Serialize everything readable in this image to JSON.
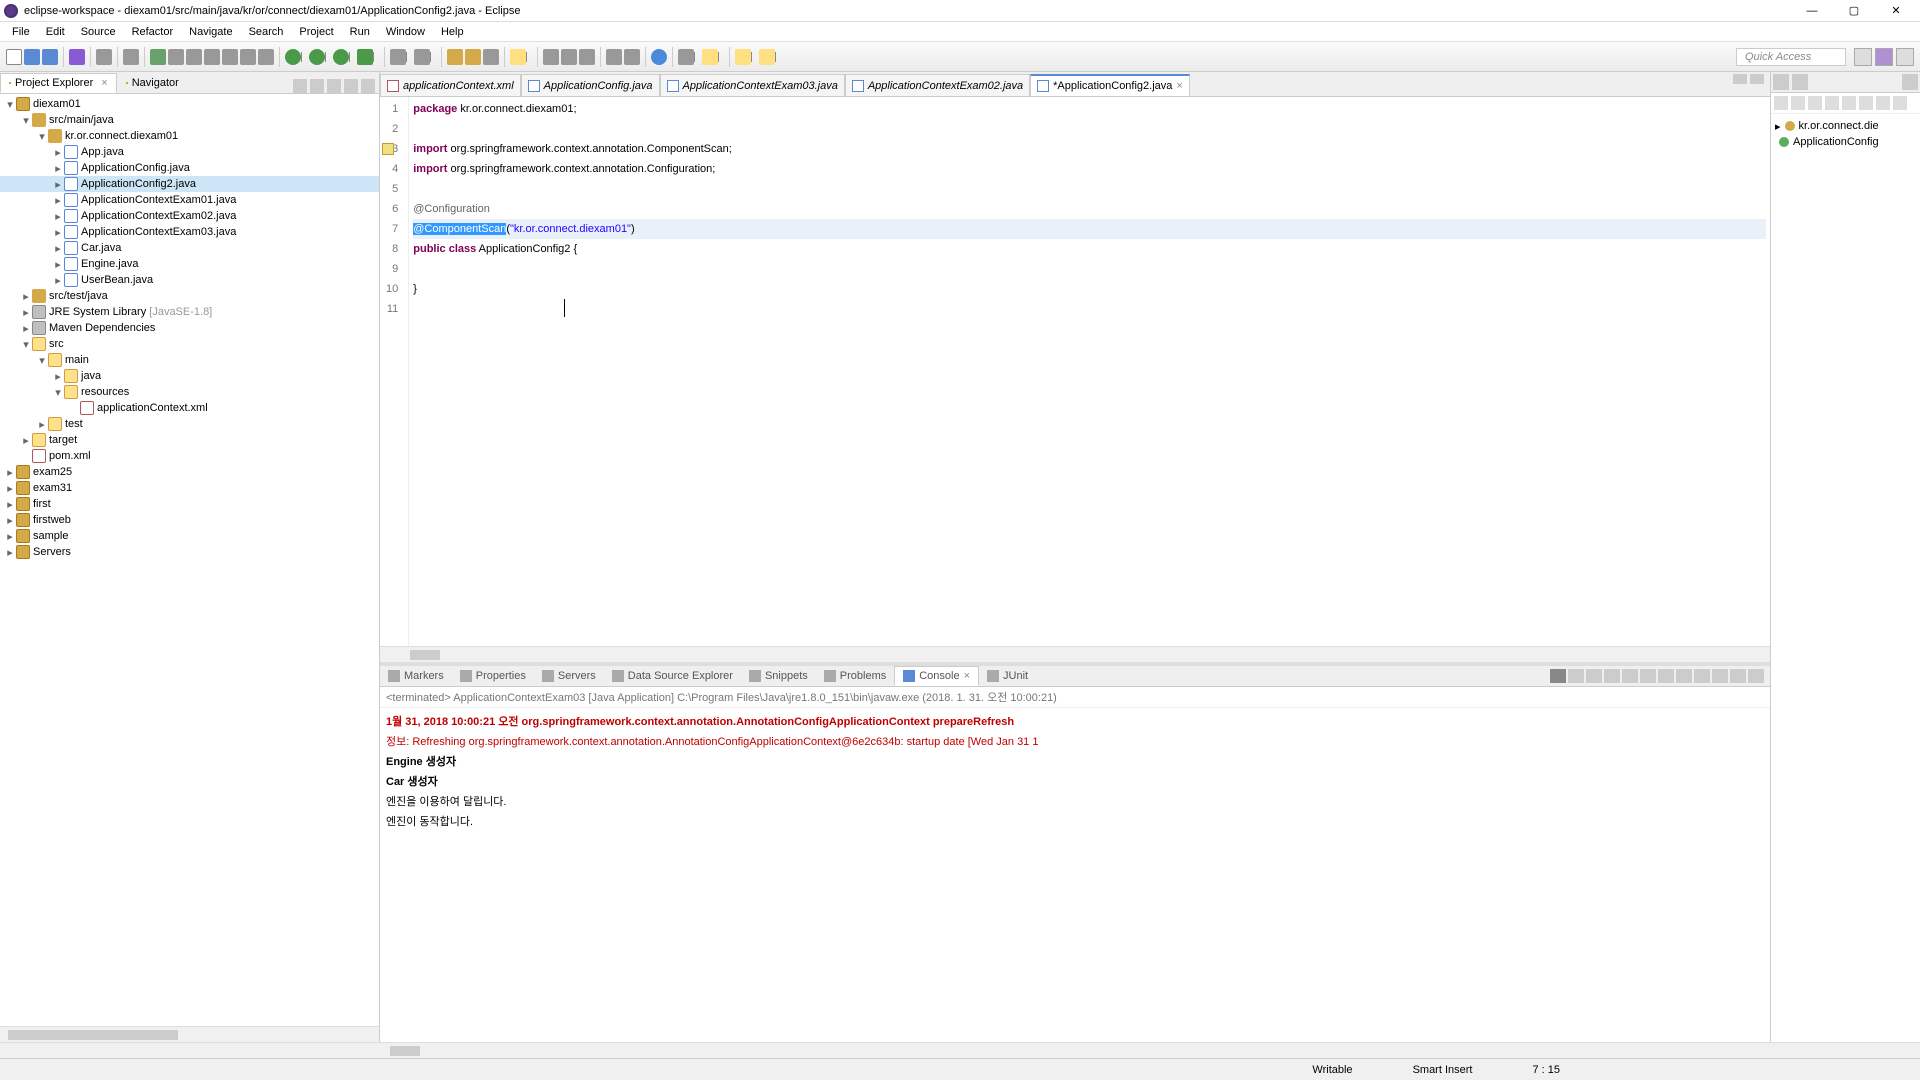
{
  "window": {
    "title": "eclipse-workspace - diexam01/src/main/java/kr/or/connect/diexam01/ApplicationConfig2.java - Eclipse"
  },
  "menu": [
    "File",
    "Edit",
    "Source",
    "Refactor",
    "Navigate",
    "Search",
    "Project",
    "Run",
    "Window",
    "Help"
  ],
  "quick_access_placeholder": "Quick Access",
  "project_explorer": {
    "title": "Project Explorer",
    "nav_title": "Navigator"
  },
  "tree": {
    "root": "diexam01",
    "n1": "src/main/java",
    "n2": "kr.or.connect.diexam01",
    "f1": "App.java",
    "f2": "ApplicationConfig.java",
    "f3": "ApplicationConfig2.java",
    "f4": "ApplicationContextExam01.java",
    "f5": "ApplicationContextExam02.java",
    "f6": "ApplicationContextExam03.java",
    "f7": "Car.java",
    "f8": "Engine.java",
    "f9": "UserBean.java",
    "n3": "src/test/java",
    "n4": "JRE System Library",
    "n4v": "[JavaSE-1.8]",
    "n5": "Maven Dependencies",
    "n6": "src",
    "n7": "main",
    "n8": "java",
    "n9": "resources",
    "f10": "applicationContext.xml",
    "n10": "test",
    "n11": "target",
    "f11": "pom.xml",
    "p2": "exam25",
    "p3": "exam31",
    "p4": "first",
    "p5": "firstweb",
    "p6": "sample",
    "p7": "Servers"
  },
  "editor_tabs": [
    {
      "label": "applicationContext.xml",
      "kind": "x"
    },
    {
      "label": "ApplicationConfig.java",
      "kind": "j"
    },
    {
      "label": "ApplicationContextExam03.java",
      "kind": "j"
    },
    {
      "label": "ApplicationContextExam02.java",
      "kind": "j"
    },
    {
      "label": "*ApplicationConfig2.java",
      "kind": "j",
      "active": true
    }
  ],
  "code": {
    "l1a": "package",
    "l1b": " kr.or.connect.diexam01;",
    "l3a": "import",
    "l3b": " org.springframework.context.annotation.ComponentScan;",
    "l4a": "import",
    "l4b": " org.springframework.context.annotation.Configuration;",
    "l6": "@Configuration",
    "l7a": "@ComponentScan",
    "l7b": "(",
    "l7c": "\"kr.or.connect.diexam01\"",
    "l7d": ")",
    "l8a": "public",
    "l8b": " ",
    "l8c": "class",
    "l8d": " ApplicationConfig2 {",
    "l10": "}"
  },
  "line_numbers": [
    "1",
    "2",
    "3",
    "4",
    "5",
    "6",
    "7",
    "8",
    "9",
    "10",
    "11"
  ],
  "bottom_tabs": {
    "markers": "Markers",
    "properties": "Properties",
    "servers": "Servers",
    "dse": "Data Source Explorer",
    "snippets": "Snippets",
    "problems": "Problems",
    "console": "Console",
    "junit": "JUnit"
  },
  "console": {
    "term": "<terminated> ApplicationContextExam03 [Java Application] C:\\Program Files\\Java\\jre1.8.0_151\\bin\\javaw.exe (2018. 1. 31. 오전 10:00:21)",
    "l1": "1월 31, 2018 10:00:21 오전 org.springframework.context.annotation.AnnotationConfigApplicationContext prepareRefresh",
    "l2": "정보: Refreshing org.springframework.context.annotation.AnnotationConfigApplicationContext@6e2c634b: startup date [Wed Jan 31 1",
    "l3": "Engine 생성자",
    "l4": "Car 생성자",
    "l5": "엔진을 이용하여 달립니다.",
    "l6": "엔진이 동작합니다."
  },
  "outline": {
    "i1": "kr.or.connect.die",
    "i2": "ApplicationConfig"
  },
  "status": {
    "writable": "Writable",
    "mode": "Smart Insert",
    "pos": "7 : 15"
  }
}
